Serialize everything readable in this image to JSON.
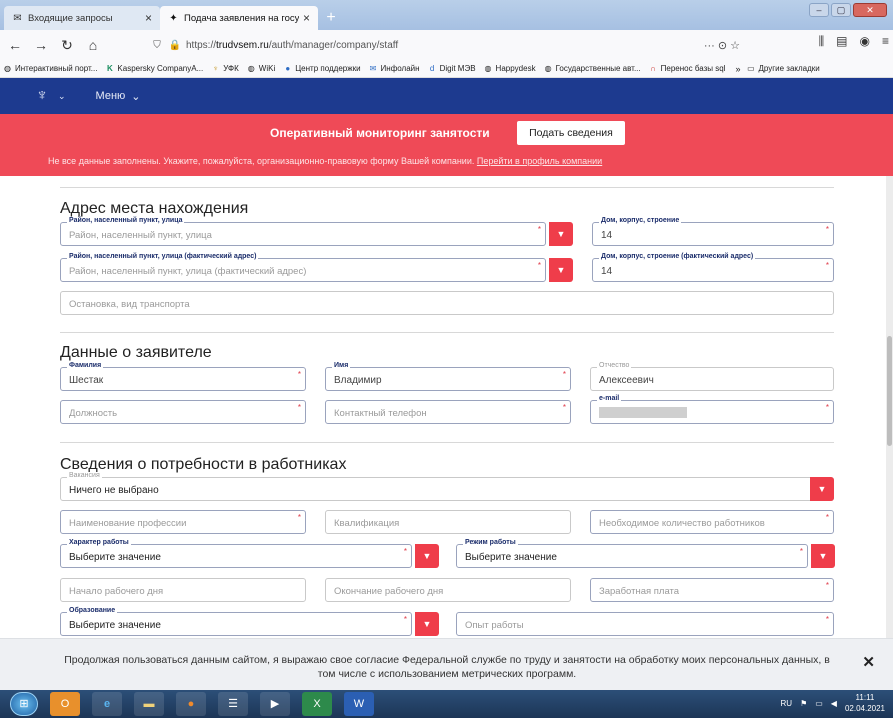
{
  "browser": {
    "tabs": [
      {
        "label": "Входящие запросы",
        "icon": "inbox-icon",
        "active": false
      },
      {
        "label": "Подача заявления на госуслу",
        "icon": "emblem-icon",
        "active": true
      }
    ],
    "url_scheme": "https://",
    "url_host": "trudvsem.ru",
    "url_path": "/auth/manager/company/staff",
    "url_actions": "··· ⊙ ☆",
    "bookmarks": [
      "Интерактивный порт...",
      "Kaspersky CompanyA...",
      "УФК",
      "WiKi",
      "Центр поддержки",
      "Инфолайн",
      "Digit МЭВ",
      "Happydesk",
      "Государственные авт...",
      "Перенос базы sql"
    ],
    "bookmarks_more": "»",
    "bookmarks_other": "Другие закладки"
  },
  "site": {
    "menu_label": "Меню",
    "alert_title": "Оперативный мониторинг занятости",
    "alert_button": "Подать сведения",
    "alert_message": "Не все данные заполнены. Укажите, пожалуйста, организационно-правовую форму Вашей компании.",
    "alert_link": "Перейти в профиль компании"
  },
  "address_section": {
    "title": "Адрес места нахождения",
    "district_label": "Район, населенный пункт, улица",
    "district_placeholder": "Район, населенный пункт, улица",
    "house_label": "Дом, корпус, строение",
    "house_value": "14",
    "district_actual_label": "Район, населенный пункт, улица (фактический адрес)",
    "district_actual_placeholder": "Район, населенный пункт, улица (фактический адрес)",
    "house_actual_label": "Дом, корпус, строение (фактический адрес)",
    "house_actual_value": "14",
    "transport_placeholder": "Остановка, вид транспорта"
  },
  "applicant_section": {
    "title": "Данные о заявителе",
    "surname_label": "Фамилия",
    "surname_value": "Шестак",
    "name_label": "Имя",
    "name_value": "Владимир",
    "patronymic_label": "Отчество",
    "patronymic_value": "Алексеевич",
    "position_placeholder": "Должность",
    "phone_placeholder": "Контактный телефон",
    "email_label": "e-mail"
  },
  "needs_section": {
    "title": "Сведения о потребности в работниках",
    "vacancy_label": "Вакансия",
    "vacancy_value": "Ничего не выбрано",
    "profession_placeholder": "Наименование профессии",
    "qualification_placeholder": "Квалификация",
    "workers_count_placeholder": "Необходимое количество работников",
    "work_type_label": "Характер работы",
    "work_type_value": "Выберите значение",
    "work_mode_label": "Режим работы",
    "work_mode_value": "Выберите значение",
    "day_start_placeholder": "Начало рабочего дня",
    "day_end_placeholder": "Окончание рабочего дня",
    "salary_placeholder": "Заработная плата",
    "education_label": "Образование",
    "education_value": "Выберите значение",
    "experience_placeholder": "Опыт работы"
  },
  "cookie_banner": {
    "text": "Продолжая пользоваться данным сайтом, я выражаю свое согласие Федеральной службе по труду и занятости на обработку моих персональных данных, в том числе с использованием метрических программ."
  },
  "taskbar": {
    "language": "RU",
    "time": "11:11",
    "date": "02.04.2021"
  },
  "colors": {
    "site_nav": "#1d3a8f",
    "alert": "#ef4a57",
    "select_button": "#ef3d4a",
    "label": "#1b2d6b"
  }
}
